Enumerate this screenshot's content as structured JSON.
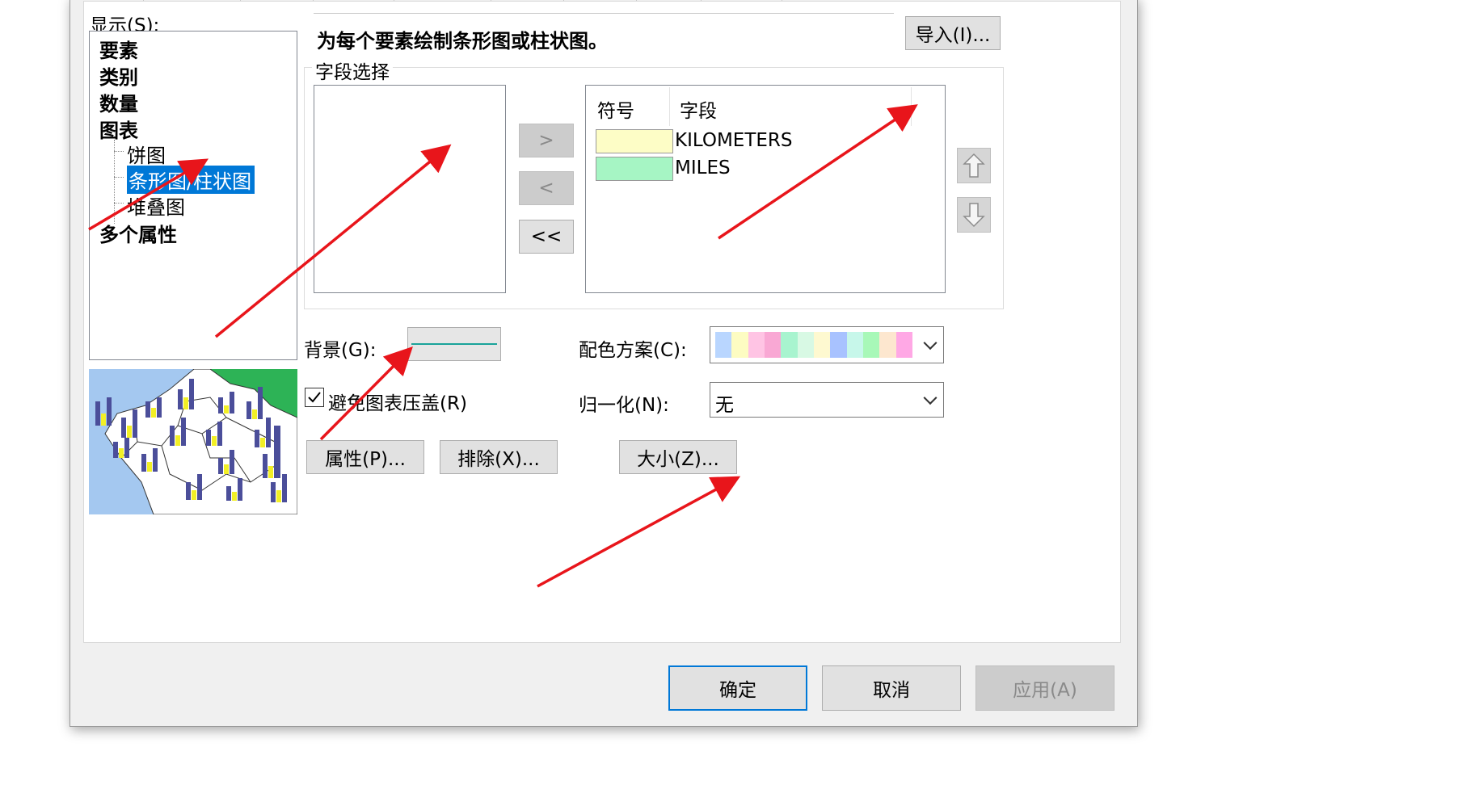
{
  "display_label": "显示(S):",
  "tree": {
    "features": "要素",
    "categories": "类别",
    "quantities": "数量",
    "charts": "图表",
    "pie": "饼图",
    "bar_column": "条形图/柱状图",
    "stacked": "堆叠图",
    "multiple_attributes": "多个属性"
  },
  "description": "为每个要素绘制条形图或柱状图。",
  "import_button": "导入(I)...",
  "field_selection": {
    "title": "字段选择",
    "move_right": ">",
    "move_left": "<",
    "move_all_left": "<<",
    "columns": {
      "symbol": "符号",
      "field": "字段"
    },
    "fields": [
      {
        "name": "KILOMETERS",
        "color": "#fdfdc6"
      },
      {
        "name": "MILES",
        "color": "#a6f5c4"
      }
    ]
  },
  "background": {
    "label": "背景(G):",
    "line_color": "#1aa39a"
  },
  "color_scheme": {
    "label": "配色方案(C):",
    "colors": [
      "#b9d6ff",
      "#fdfcc2",
      "#ffc4e4",
      "#f9a8d4",
      "#a8f4cf",
      "#d8f9e4",
      "#fef9d0",
      "#a8c2ff",
      "#c7f7ea",
      "#a8f8b8",
      "#fde7cf",
      "#ffa8e5"
    ]
  },
  "avoid_overlap": {
    "label": "避免图表压盖(R)",
    "checked": true
  },
  "normalize": {
    "label": "归一化(N):",
    "value": "无"
  },
  "buttons": {
    "properties": "属性(P)...",
    "exclude": "排除(X)...",
    "size": "大小(Z)...",
    "ok": "确定",
    "cancel": "取消",
    "apply": "应用(A)"
  },
  "colors": {
    "selection": "#0078d7",
    "arrow": "#e8151b",
    "map_sea": "#a4c8f0",
    "map_land": "#ffffff",
    "map_green": "#2db356",
    "bar_dark": "#4b4e9a",
    "bar_yellow": "#f2ef26"
  },
  "icons": {
    "move_up": "arrow-up-icon",
    "move_down": "arrow-down-icon",
    "dropdown": "chevron-down-icon"
  }
}
